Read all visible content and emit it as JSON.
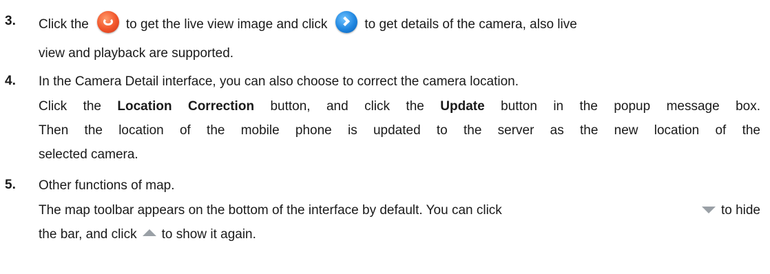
{
  "steps": [
    {
      "number": "3.",
      "line1_a": "Click the",
      "line1_b": "to get the live view image and click",
      "line1_c": "to get details of the camera, also live",
      "line2": "view and playback are supported."
    },
    {
      "number": "4.",
      "line1": "In the Camera Detail interface, you can also choose to correct the camera location.",
      "line2_a": "Click the ",
      "line2_bold1": "Location Correction",
      "line2_b": " button, and click the ",
      "line2_bold2": "Update",
      "line2_c": " button in the popup message box.",
      "line3": "Then the location of the mobile phone is updated to the server as the new location of the",
      "line4": "selected camera."
    },
    {
      "number": "5.",
      "line1": "Other functions of map.",
      "line2_a": "The map toolbar appears on the bottom of the interface by default. You can click",
      "line2_b": "to hide",
      "line3_a": "the bar, and click",
      "line3_b": "to show it again."
    }
  ],
  "icons": {
    "live_view": "live-view-icon",
    "details": "camera-details-arrow-icon",
    "hide_bar": "hide-toolbar-icon",
    "show_bar": "show-toolbar-icon"
  }
}
